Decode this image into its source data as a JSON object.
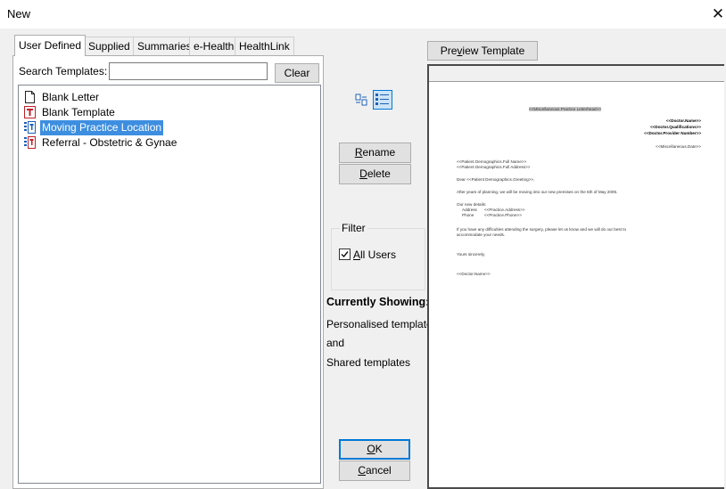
{
  "window": {
    "title": "New",
    "close_glyph": "✕"
  },
  "tabs": [
    "User Defined",
    "Supplied",
    "Summaries",
    "e-Health",
    "HealthLink"
  ],
  "search": {
    "label": "Search Templates:",
    "value": "",
    "clear_label": "Clear"
  },
  "templates": [
    {
      "label": "Blank Letter",
      "icon": "blank-document-icon"
    },
    {
      "label": "Blank Template",
      "icon": "template-icon"
    },
    {
      "label": "Moving Practice Location",
      "icon": "shared-template-icon",
      "selected": true
    },
    {
      "label": "Referral - Obstetric & Gynae",
      "icon": "shared-template-icon"
    }
  ],
  "view_buttons": {
    "list_icon": "small-icons-view-icon",
    "detail_icon": "list-view-icon"
  },
  "actions": {
    "rename_label": "Rename",
    "rename_key": "R",
    "rename_rest": "ename",
    "delete_label": "Delete",
    "delete_key": "D",
    "delete_rest": "elete",
    "ok_label": "OK",
    "ok_key": "O",
    "ok_rest": "K",
    "cancel_label": "Cancel",
    "cancel_key": "C",
    "cancel_rest": "ancel"
  },
  "filter": {
    "legend": "Filter",
    "all_users_label": "All Users",
    "all_users_key": "A",
    "all_users_rest": "ll Users",
    "all_users_checked": true
  },
  "currently_showing": {
    "heading": "Currently Showing:",
    "line1": "Personalised templates",
    "line2": "and",
    "line3": "Shared templates"
  },
  "preview": {
    "button_label": "Preview Template",
    "button_pre": "Pre",
    "button_key": "v",
    "button_post": "iew Template",
    "letter": {
      "header": "<<Miscellaneous.Practice Letterhead>>",
      "doctor_name": "<<Doctor.Name>>",
      "doctor_qual": "<<Doctor.Qualifications>>",
      "doctor_provider": "<<Doctor.Provider Number>>",
      "date": "<<Miscellaneous.Date>>",
      "patient_name": "<<Patient Demographics.Full Name>>",
      "patient_address": "<<Patient Demographics.Full Address>>",
      "greeting": "Dear <<Patient Demographics.Greeting>>,",
      "para1": "After years of planning, we will be moving into our new premises on the 5th of May 2005.",
      "details_heading": "Our new details:",
      "address_label": "Address",
      "address_value": "<<Practice.Address>>",
      "phone_label": "Phone",
      "phone_value": "<<Practice.Phone>>",
      "para2a": "If you have any difficulties attending the surgery, please let us know and we will do our best to",
      "para2b": "accommodate your needs.",
      "closing": "Yours sincerely,",
      "signature": "<<Doctor.Name>>"
    }
  },
  "colors": {
    "selection": "#3d8ee0",
    "default_button_border": "#0078d7",
    "template_icon_red": "#c0202a"
  }
}
